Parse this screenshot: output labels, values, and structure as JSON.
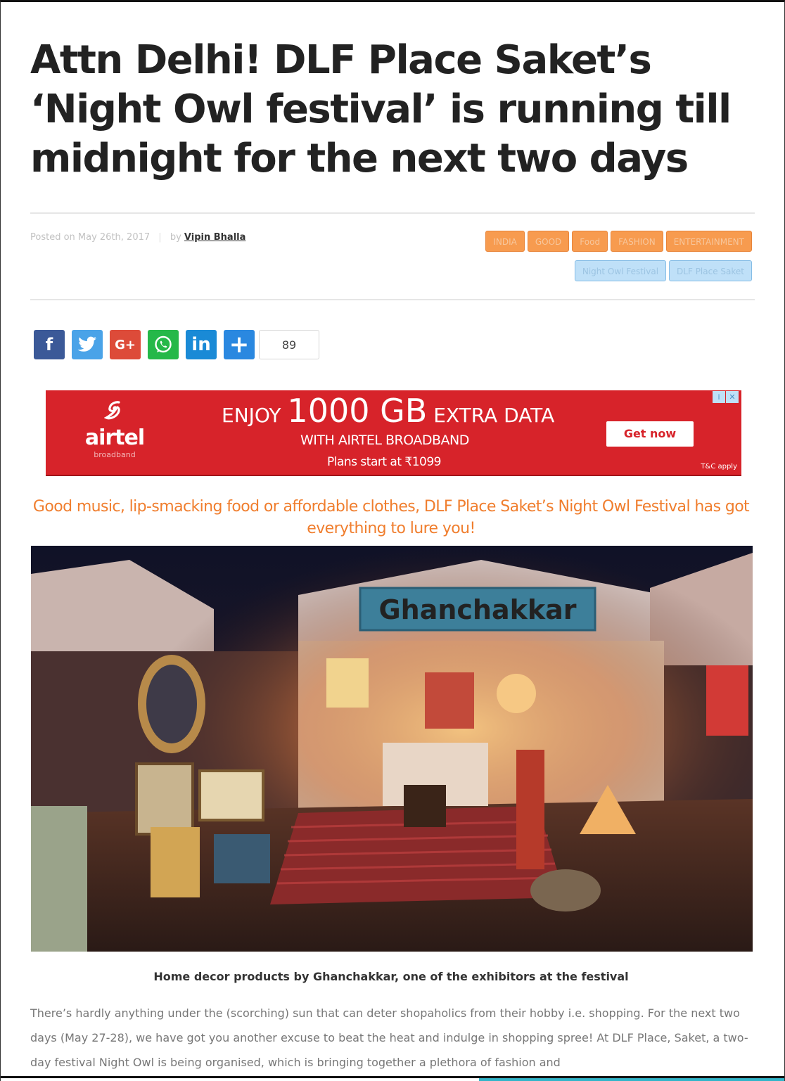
{
  "article": {
    "headline": "Attn Delhi! DLF Place Saket’s ‘Night Owl festival’ is running till midnight for the next two days",
    "posted_on": "Posted on May 26th, 2017",
    "byline_prefix": "by",
    "author": "Vipin Bhalla",
    "tags_row1": [
      "INDIA",
      "GOOD",
      "Food",
      "FASHION",
      "ENTERTAINMENT"
    ],
    "tags_row2": [
      "Night Owl Festival",
      "DLF Place Saket"
    ],
    "lede": "Good music, lip-smacking food or affordable clothes, DLF Place Saket’s Night Owl Festival has got everything to lure you!",
    "caption": "Home decor products by Ghanchakkar, one of the exhibitors at the festival",
    "body": "There’s hardly anything under the (scorching) sun that can deter shopaholics from their hobby i.e. shopping. For the next two days (May 27-28), we have got you another excuse to beat the heat and indulge in shopping spree! At DLF Place, Saket, a two-day festival Night Owl is being organised, which is bringing together a plethora of fashion and"
  },
  "share": {
    "buttons": [
      {
        "name": "facebook",
        "label": "f",
        "icon": "facebook-icon"
      },
      {
        "name": "twitter",
        "label": "t",
        "icon": "twitter-icon"
      },
      {
        "name": "google-plus",
        "label": "G+",
        "icon": "google-plus-icon"
      },
      {
        "name": "whatsapp",
        "label": "w",
        "icon": "whatsapp-icon"
      },
      {
        "name": "linkedin",
        "label": "in",
        "icon": "linkedin-icon"
      },
      {
        "name": "more",
        "label": "+",
        "icon": "plus-icon"
      }
    ],
    "count": "89"
  },
  "ad": {
    "brand": "airtel",
    "brand_sub": "broadband",
    "headline_pre": "ENJOY",
    "headline_big": "1000 GB",
    "headline_post": "EXTRA DATA",
    "line2": "WITH AIRTEL BROADBAND",
    "line3": "Plans start at ₹1099",
    "cta": "Get now",
    "terms": "T&C apply",
    "badge_info": "i",
    "badge_close": "✕"
  },
  "photo": {
    "sign_text": "Ghanchakkar"
  },
  "colors": {
    "accent_orange": "#f07e2e",
    "tag_orange": "#f79b4f",
    "tag_blue": "#bfe0f8",
    "ad_red": "#d7232a"
  }
}
